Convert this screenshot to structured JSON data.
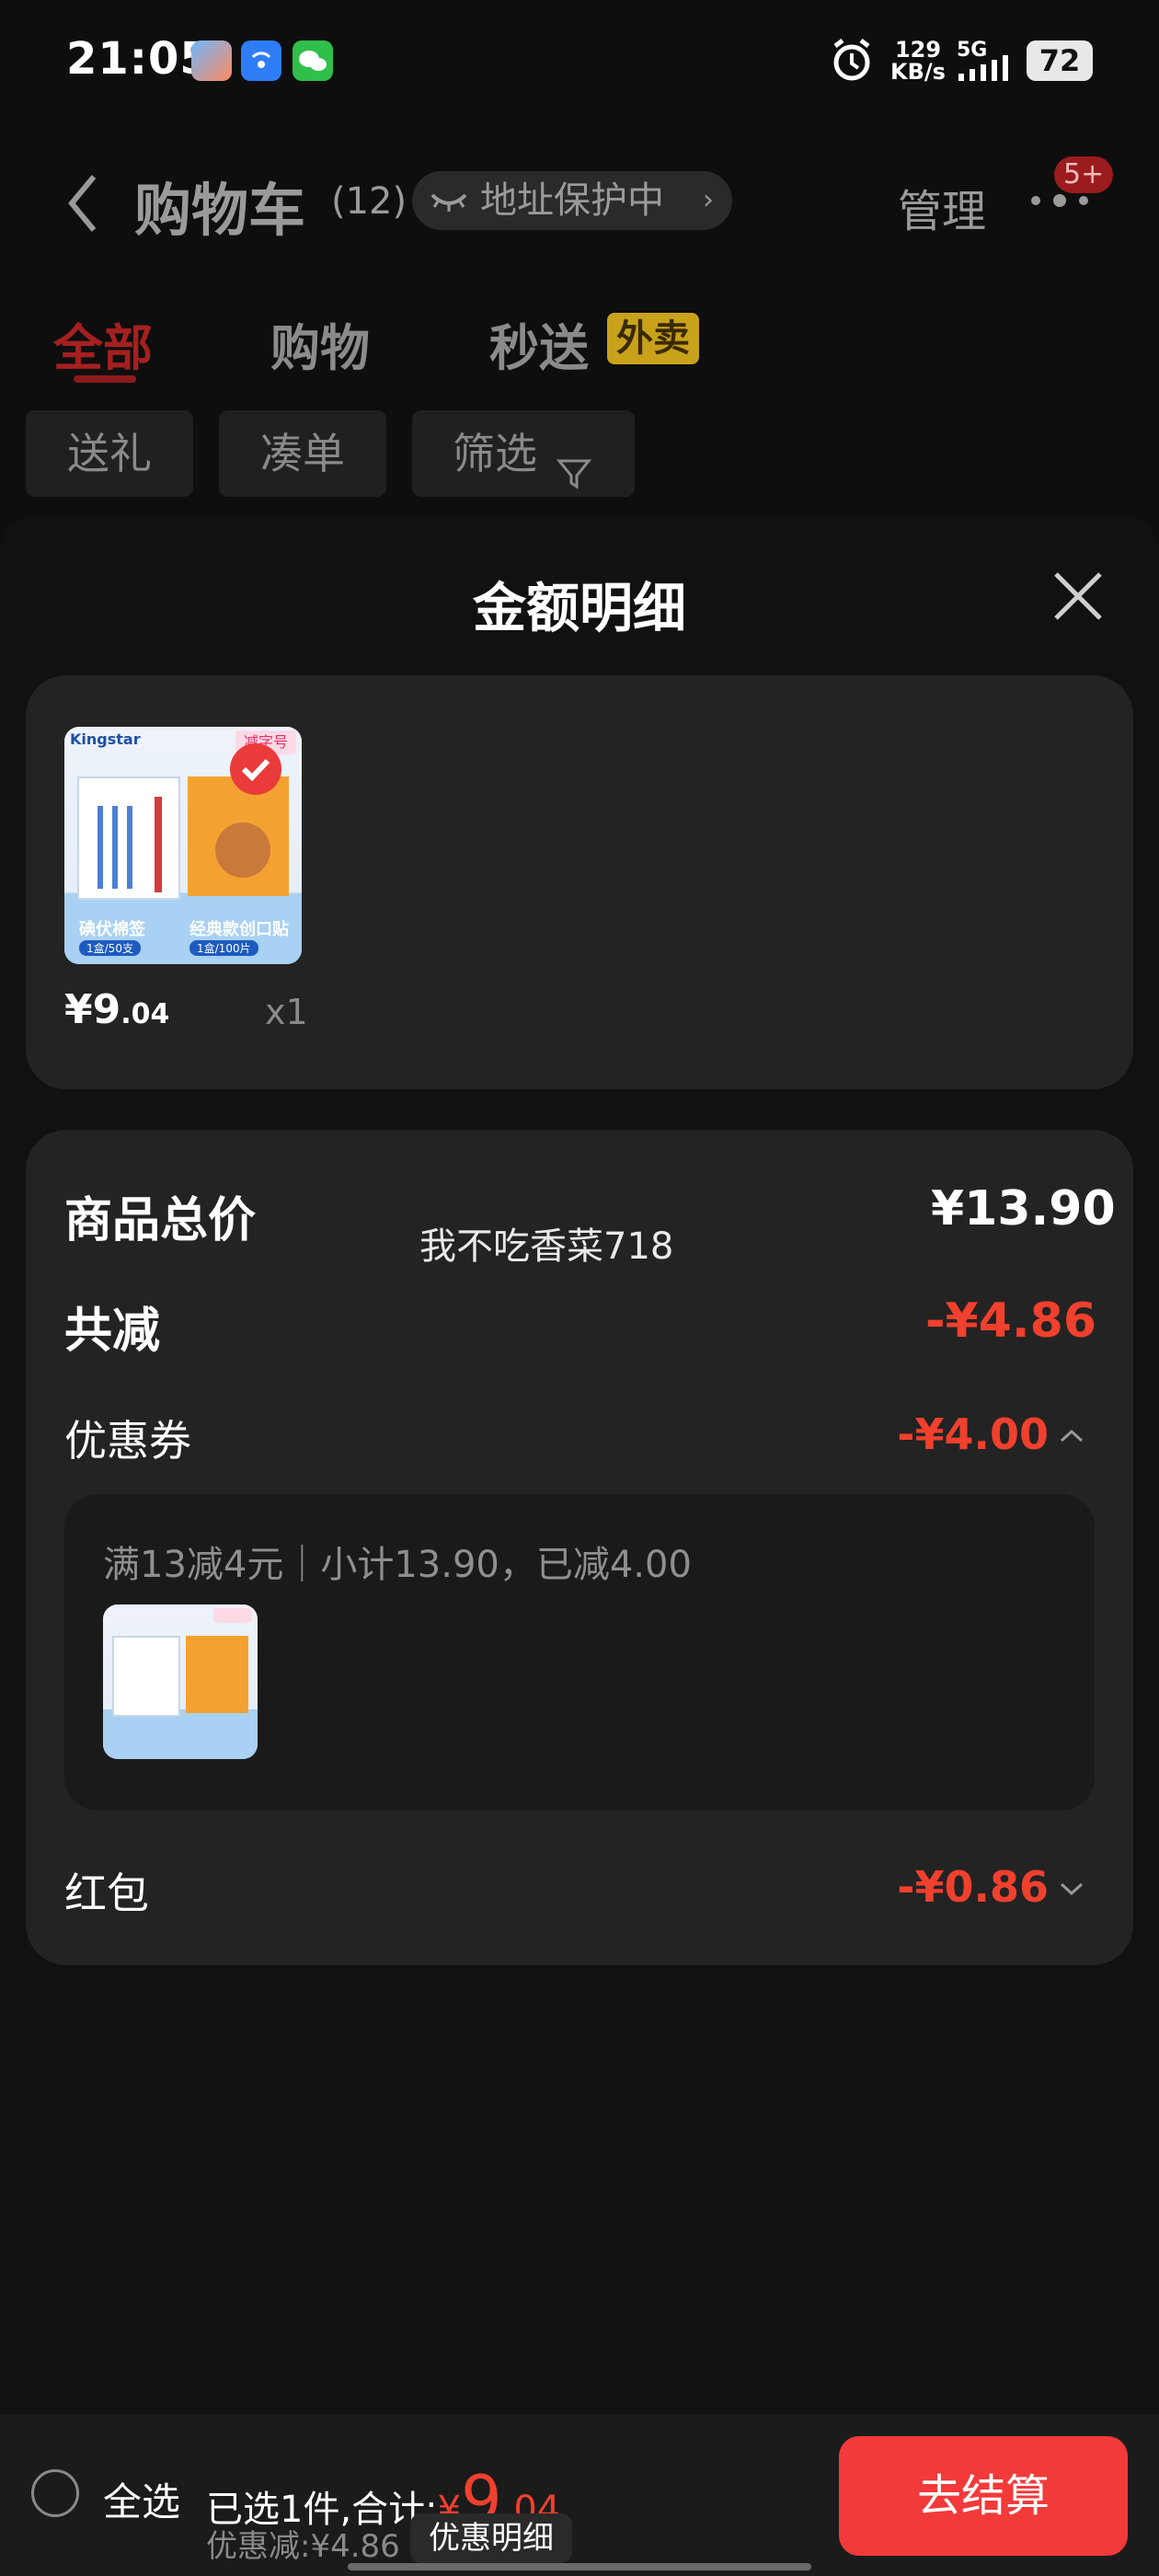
{
  "status_bar": {
    "time": "21:05",
    "net_speed_value": "129",
    "net_speed_unit": "KB/s",
    "network": "5G",
    "battery": "72"
  },
  "header": {
    "title": "购物车",
    "count": "(12)",
    "address_chip": "地址保护中",
    "manage": "管理",
    "badge": "5+"
  },
  "tabs": [
    {
      "label": "全部"
    },
    {
      "label": "购物"
    },
    {
      "label": "秒送"
    }
  ],
  "waimai_tag": "外卖",
  "chips": [
    {
      "label": "送礼"
    },
    {
      "label": "凑单"
    },
    {
      "label": "筛选"
    }
  ],
  "sheet": {
    "title": "金额明细",
    "product": {
      "price_main": "¥9",
      "price_cents": ".04",
      "qty": "x1",
      "thumb_brand": "Kingstar",
      "thumb_tag": "减字号",
      "thumb_left_caption": "碘伏棉签",
      "thumb_right_caption": "经典款创口贴",
      "thumb_left_sub": "1盒/50支",
      "thumb_right_sub": "1盒/100片"
    },
    "total_label": "商品总价",
    "total_value": "¥13.90",
    "watermark": "我不吃香菜718",
    "discount_label": "共减",
    "discount_value": "-¥4.86",
    "coupon_label": "优惠券",
    "coupon_value": "-¥4.00",
    "coupon_detail": "满13减4元｜小计13.90，已减4.00",
    "redpacket_label": "红包",
    "redpacket_value": "-¥0.86"
  },
  "bottom": {
    "select_all": "全选",
    "selected_text": "已选1件,合计:",
    "total_symbol": "¥",
    "total_main": "9",
    "total_cents": ".04",
    "discount_text": "优惠减:¥4.86",
    "detail_button": "优惠明细",
    "checkout": "去结算"
  }
}
